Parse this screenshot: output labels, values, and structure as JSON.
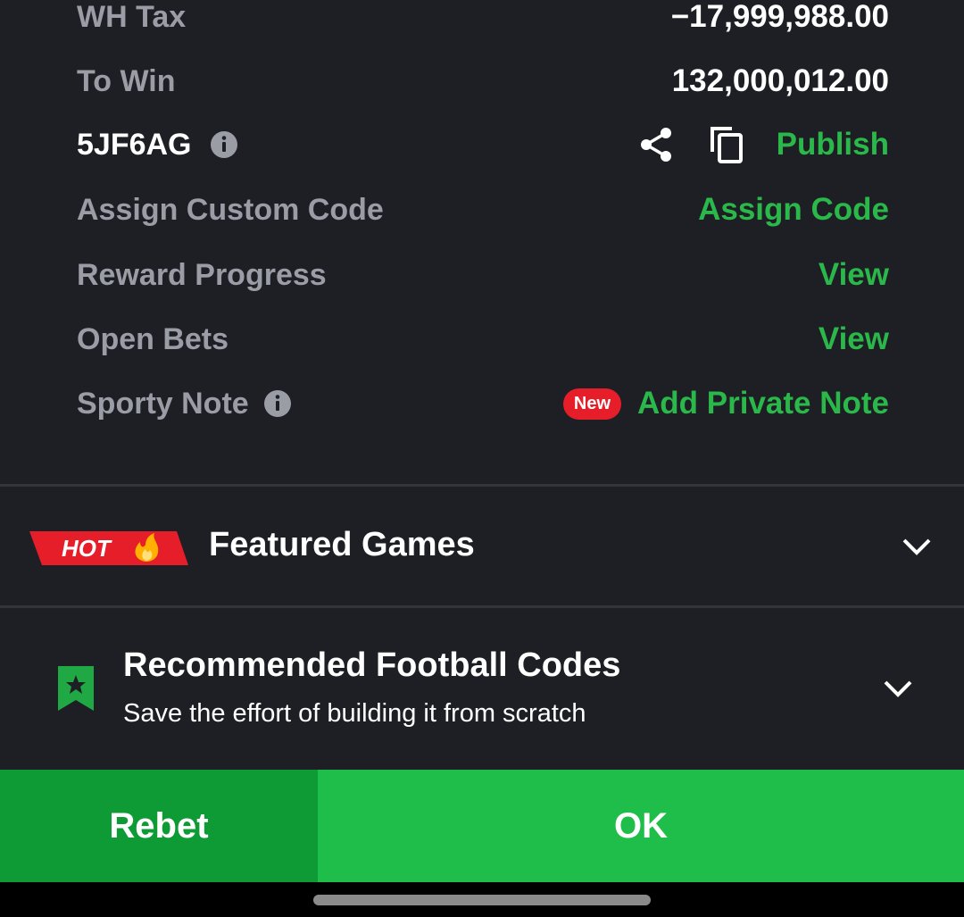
{
  "summary": {
    "wh_tax": {
      "label": "WH Tax",
      "value": "−17,999,988.00"
    },
    "to_win": {
      "label": "To Win",
      "value": "132,000,012.00"
    },
    "booking": {
      "code": "5JF6AG",
      "publish_label": "Publish"
    },
    "custom_code": {
      "label": "Assign Custom Code",
      "action": "Assign Code"
    },
    "reward": {
      "label": "Reward Progress",
      "action": "View"
    },
    "open_bets": {
      "label": "Open Bets",
      "action": "View"
    },
    "note": {
      "label": "Sporty Note",
      "badge": "New",
      "action": "Add Private Note"
    }
  },
  "featured": {
    "badge": "HOT",
    "title": "Featured Games"
  },
  "recommended": {
    "title": "Recommended Football Codes",
    "subtitle": "Save the effort of building it from scratch"
  },
  "actions": {
    "rebet": "Rebet",
    "ok": "OK"
  },
  "colors": {
    "background": "#1e1f24",
    "accent_green": "#2bb84a",
    "ok_button": "#1fbe4b",
    "rebet_button": "#0e9a35",
    "badge_red": "#e51e2a"
  },
  "icons": [
    "info-icon",
    "share-icon",
    "copy-icon",
    "hot-fire-badge",
    "chevron-down-icon",
    "bookmark-star-icon"
  ]
}
